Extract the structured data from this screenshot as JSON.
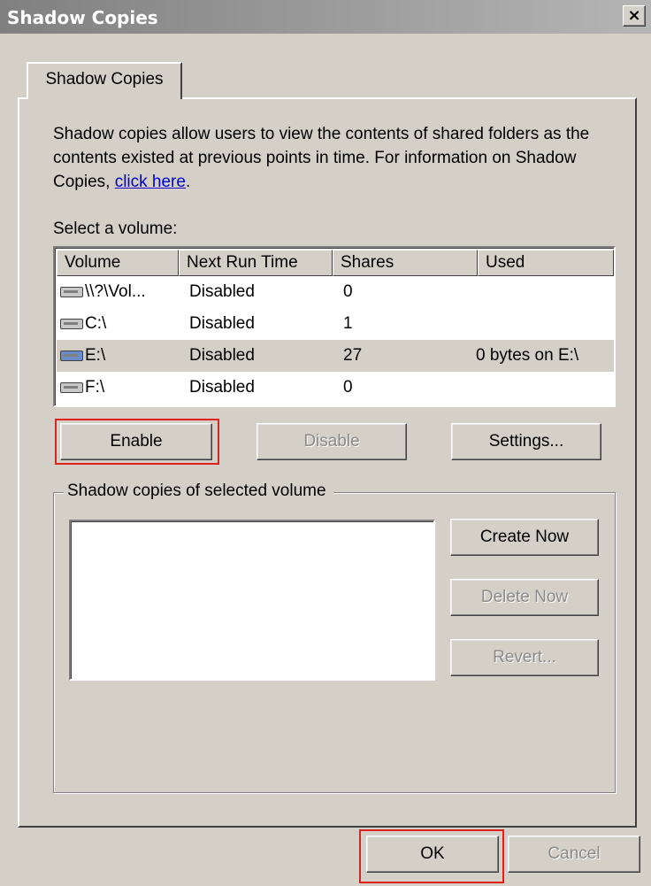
{
  "window": {
    "title": "Shadow Copies",
    "close_label": "×"
  },
  "tab": {
    "label": "Shadow Copies"
  },
  "description": {
    "text": "Shadow copies allow users to view the contents of shared folders as the contents existed at previous points in time. For information on Shadow Copies, ",
    "link": "click here",
    "suffix": "."
  },
  "volume_select": {
    "label": "Select a volume:",
    "columns": [
      "Volume",
      "Next Run Time",
      "Shares",
      "Used"
    ],
    "rows": [
      {
        "volume": "\\\\?\\Vol...",
        "next_run": "Disabled",
        "shares": "0",
        "used": "",
        "selected": false
      },
      {
        "volume": "C:\\",
        "next_run": "Disabled",
        "shares": "1",
        "used": "",
        "selected": false
      },
      {
        "volume": "E:\\",
        "next_run": "Disabled",
        "shares": "27",
        "used": "0 bytes on E:\\",
        "selected": true
      },
      {
        "volume": "F:\\",
        "next_run": "Disabled",
        "shares": "0",
        "used": "",
        "selected": false
      }
    ]
  },
  "buttons": {
    "enable": "Enable",
    "disable": "Disable",
    "settings": "Settings...",
    "create_now": "Create Now",
    "delete_now": "Delete Now",
    "revert": "Revert...",
    "ok": "OK",
    "cancel": "Cancel"
  },
  "snapshots": {
    "group_label": "Shadow copies of selected volume"
  },
  "colors": {
    "highlight": "#e0201a",
    "link": "#0000cc",
    "face": "#d4d0c8"
  }
}
